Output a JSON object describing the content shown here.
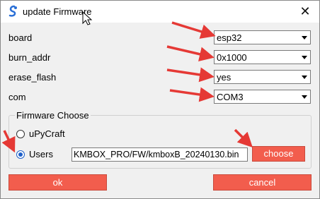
{
  "window": {
    "title": "update Firmware"
  },
  "fields": [
    {
      "label": "board",
      "value": "esp32"
    },
    {
      "label": "burn_addr",
      "value": "0x1000"
    },
    {
      "label": "erase_flash",
      "value": "yes"
    },
    {
      "label": "com",
      "value": "COM3"
    }
  ],
  "firmware": {
    "group_title": "Firmware Choose",
    "option_upycraft": "uPyCraft",
    "option_users": "Users",
    "path": "KMBOX_PRO/FW/kmboxB_20240130.bin",
    "choose_label": "choose"
  },
  "buttons": {
    "ok": "ok",
    "cancel": "cancel"
  },
  "colors": {
    "accent_button": "#f25d4d",
    "annotation_arrow": "#e53935",
    "radio_selected": "#1e5fc9"
  }
}
